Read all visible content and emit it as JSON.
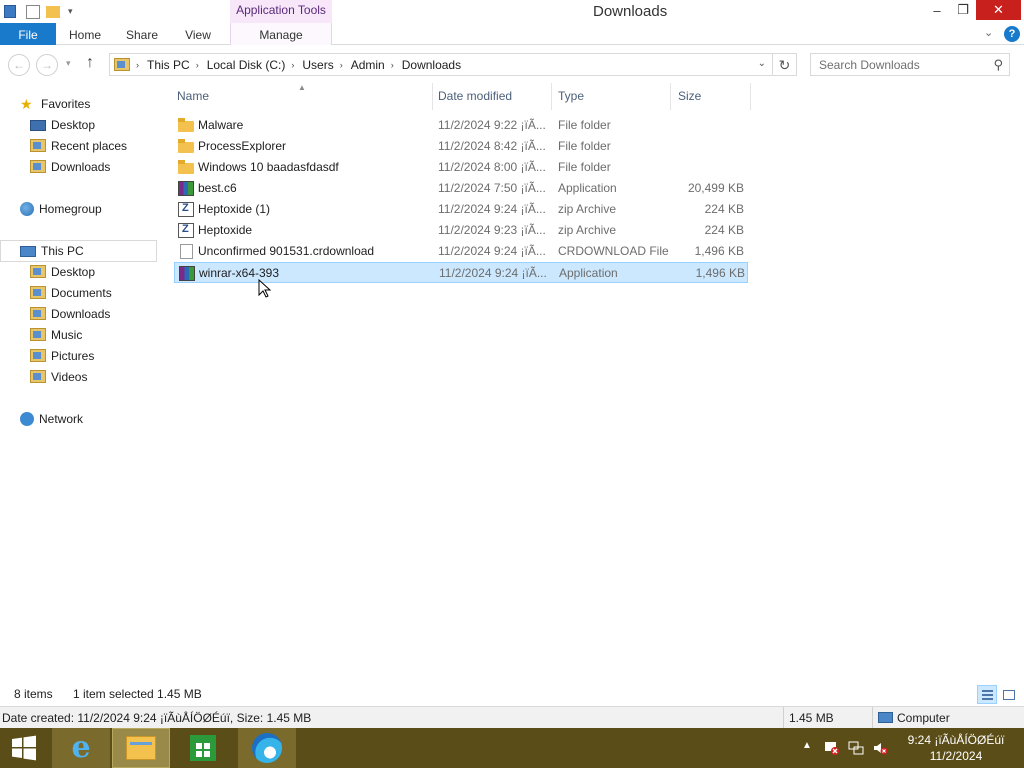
{
  "window": {
    "title": "Downloads",
    "context_tab": "Application Tools",
    "controls": {
      "minimize": "–",
      "maximize": "❐",
      "close": "✕"
    }
  },
  "ribbon": {
    "tabs": [
      "File",
      "Home",
      "Share",
      "View",
      "Manage"
    ],
    "help": "?"
  },
  "navbar": {
    "back": "←",
    "forward": "→",
    "up": "↑",
    "breadcrumb": [
      "This PC",
      "Local Disk (C:)",
      "Users",
      "Admin",
      "Downloads"
    ],
    "search_placeholder": "Search Downloads"
  },
  "sidebar": {
    "favorites": {
      "label": "Favorites",
      "items": [
        "Desktop",
        "Recent places",
        "Downloads"
      ]
    },
    "homegroup": "Homegroup",
    "thispc": {
      "label": "This PC",
      "items": [
        "Desktop",
        "Documents",
        "Downloads",
        "Music",
        "Pictures",
        "Videos"
      ]
    },
    "network": "Network"
  },
  "list": {
    "columns": [
      "Name",
      "Date modified",
      "Type",
      "Size"
    ],
    "rows": [
      {
        "name": "Malware",
        "date": "11/2/2024 9:22 ¡ïÃ...",
        "type": "File folder",
        "size": "",
        "icon": "folder-icon"
      },
      {
        "name": "ProcessExplorer",
        "date": "11/2/2024 8:42 ¡ïÃ...",
        "type": "File folder",
        "size": "",
        "icon": "folder-icon"
      },
      {
        "name": "Windows 10 baadasfdasdf",
        "date": "11/2/2024 8:00 ¡ïÃ...",
        "type": "File folder",
        "size": "",
        "icon": "folder-icon"
      },
      {
        "name": "best.c6",
        "date": "11/2/2024 7:50 ¡ïÃ...",
        "type": "Application",
        "size": "20,499 KB",
        "icon": "winrar-icon"
      },
      {
        "name": "Heptoxide (1)",
        "date": "11/2/2024 9:24 ¡ïÃ...",
        "type": "zip Archive",
        "size": "224 KB",
        "icon": "zip-icon"
      },
      {
        "name": "Heptoxide",
        "date": "11/2/2024 9:23 ¡ïÃ...",
        "type": "zip Archive",
        "size": "224 KB",
        "icon": "zip-icon"
      },
      {
        "name": "Unconfirmed 901531.crdownload",
        "date": "11/2/2024 9:24 ¡ïÃ...",
        "type": "CRDOWNLOAD File",
        "size": "1,496 KB",
        "icon": "file-icon"
      },
      {
        "name": "winrar-x64-393",
        "date": "11/2/2024 9:24 ¡ïÃ...",
        "type": "Application",
        "size": "1,496 KB",
        "icon": "winrar-icon",
        "selected": true
      }
    ]
  },
  "status": {
    "count": "8 items",
    "selection": "1 item selected  1.45 MB"
  },
  "details": {
    "info": "Date created: 11/2/2024 9:24 ¡ïÃùÅÍÖØÉúï, Size: 1.45 MB",
    "size": "1.45 MB",
    "location": "Computer"
  },
  "taskbar": {
    "clock_time": "9:24 ¡ïÃùÅÍÖØÉúï",
    "clock_date": "11/2/2024"
  },
  "colors": {
    "accent": "#1979ca",
    "selection": "#cce8ff",
    "taskbar": "#5b4d18",
    "close": "#c7201d"
  }
}
